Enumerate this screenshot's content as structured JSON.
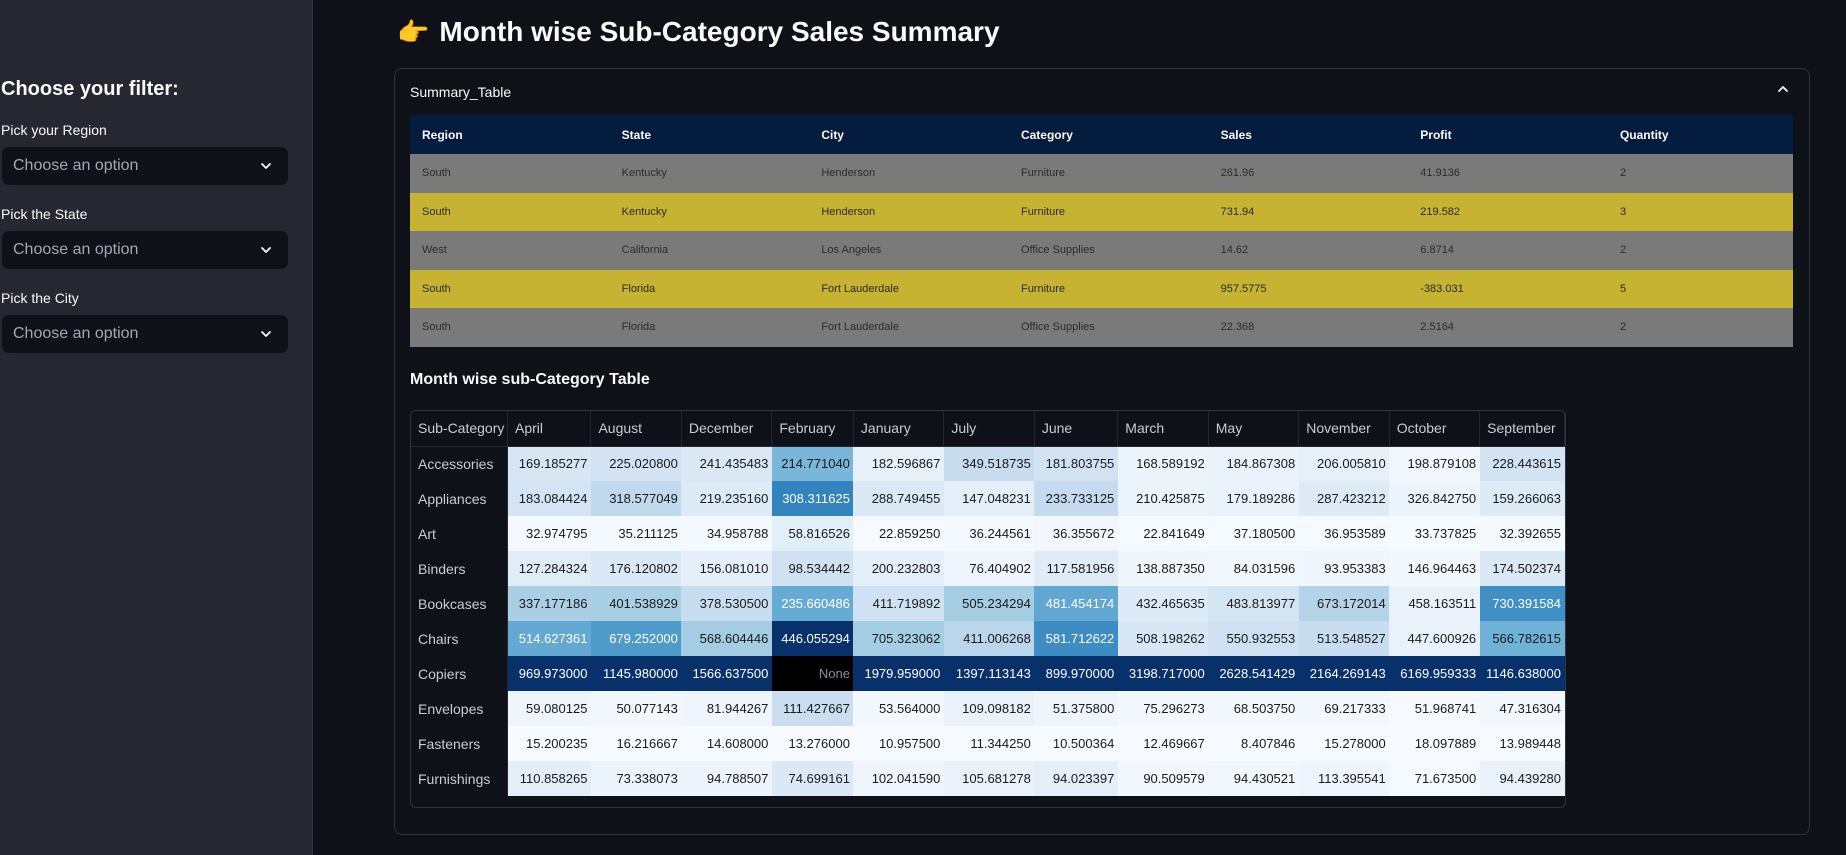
{
  "sidebar": {
    "heading": "Choose your filter:",
    "filters": [
      {
        "label": "Pick your Region",
        "placeholder": "Choose an option"
      },
      {
        "label": "Pick the State",
        "placeholder": "Choose an option"
      },
      {
        "label": "Pick the City",
        "placeholder": "Choose an option"
      }
    ]
  },
  "main": {
    "title_emoji": "👉",
    "title": "Month wise Sub-Category Sales Summary",
    "expander_title": "Summary_Table",
    "summary": {
      "headers": [
        "Region",
        "State",
        "City",
        "Category",
        "Sales",
        "Profit",
        "Quantity"
      ],
      "rows": [
        [
          "South",
          "Kentucky",
          "Henderson",
          "Furniture",
          "261.96",
          "41.9136",
          "2"
        ],
        [
          "South",
          "Kentucky",
          "Henderson",
          "Furniture",
          "731.94",
          "219.582",
          "3"
        ],
        [
          "West",
          "California",
          "Los Angeles",
          "Office Supplies",
          "14.62",
          "6.8714",
          "2"
        ],
        [
          "South",
          "Florida",
          "Fort Lauderdale",
          "Furniture",
          "957.5775",
          "-383.031",
          "5"
        ],
        [
          "South",
          "Florida",
          "Fort Lauderdale",
          "Office Supplies",
          "22.368",
          "2.5164",
          "2"
        ]
      ],
      "row_colors": [
        "#7a7a7a",
        "#c6b332",
        "#7a7a7a",
        "#c6b332",
        "#7a7a7a"
      ]
    },
    "month_table_title": "Month wise sub-Category Table",
    "month_table": {
      "headers": [
        "Sub-Category",
        "April",
        "August",
        "December",
        "February",
        "January",
        "July",
        "June",
        "March",
        "May",
        "November",
        "October",
        "September"
      ],
      "rows": [
        {
          "name": "Accessories",
          "values": [
            "169.185277",
            "225.020800",
            "241.435483",
            "214.771040",
            "182.596867",
            "349.518735",
            "181.803755",
            "168.589192",
            "184.867308",
            "206.005810",
            "198.879108",
            "228.443615"
          ]
        },
        {
          "name": "Appliances",
          "values": [
            "183.084424",
            "318.577049",
            "219.235160",
            "308.311625",
            "288.749455",
            "147.048231",
            "233.733125",
            "210.425875",
            "179.189286",
            "287.423212",
            "326.842750",
            "159.266063"
          ]
        },
        {
          "name": "Art",
          "values": [
            "32.974795",
            "35.211125",
            "34.958788",
            "58.816526",
            "22.859250",
            "36.244561",
            "36.355672",
            "22.841649",
            "37.180500",
            "36.953589",
            "33.737825",
            "32.392655"
          ]
        },
        {
          "name": "Binders",
          "values": [
            "127.284324",
            "176.120802",
            "156.081010",
            "98.534442",
            "200.232803",
            "76.404902",
            "117.581956",
            "138.887350",
            "84.031596",
            "93.953383",
            "146.964463",
            "174.502374"
          ]
        },
        {
          "name": "Bookcases",
          "values": [
            "337.177186",
            "401.538929",
            "378.530500",
            "235.660486",
            "411.719892",
            "505.234294",
            "481.454174",
            "432.465635",
            "483.813977",
            "673.172014",
            "458.163511",
            "730.391584"
          ]
        },
        {
          "name": "Chairs",
          "values": [
            "514.627361",
            "679.252000",
            "568.604446",
            "446.055294",
            "705.323062",
            "411.006268",
            "581.712622",
            "508.198262",
            "550.932553",
            "513.548527",
            "447.600926",
            "566.782615"
          ]
        },
        {
          "name": "Copiers",
          "values": [
            "969.973000",
            "1145.980000",
            "1566.637500",
            "None",
            "1979.959000",
            "1397.113143",
            "899.970000",
            "3198.717000",
            "2628.541429",
            "2164.269143",
            "6169.959333",
            "1146.638000"
          ]
        },
        {
          "name": "Envelopes",
          "values": [
            "59.080125",
            "50.077143",
            "81.944267",
            "111.427667",
            "53.564000",
            "109.098182",
            "51.375800",
            "75.296273",
            "68.503750",
            "69.217333",
            "51.968741",
            "47.316304"
          ]
        },
        {
          "name": "Fasteners",
          "values": [
            "15.200235",
            "16.216667",
            "14.608000",
            "13.276000",
            "10.957500",
            "11.344250",
            "10.500364",
            "12.469667",
            "8.407846",
            "15.278000",
            "18.097889",
            "13.989448"
          ]
        },
        {
          "name": "Furnishings",
          "values": [
            "110.858265",
            "73.338073",
            "94.788507",
            "74.699161",
            "102.041590",
            "105.681278",
            "94.023397",
            "90.509579",
            "94.430521",
            "113.395541",
            "71.673500",
            "94.439280"
          ]
        }
      ]
    }
  }
}
